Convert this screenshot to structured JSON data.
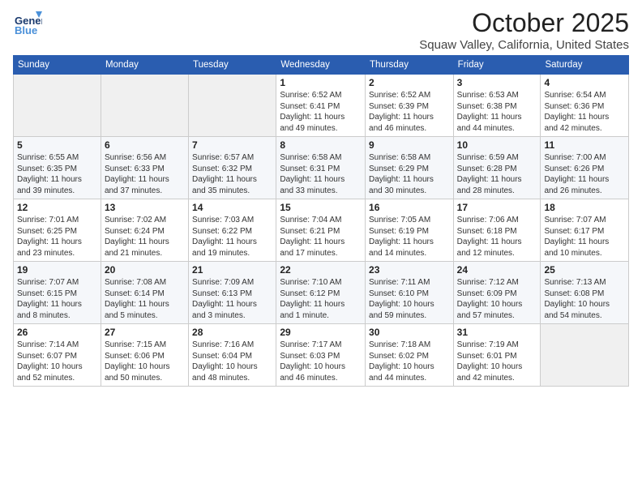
{
  "header": {
    "logo_general": "General",
    "logo_blue": "Blue",
    "month_title": "October 2025",
    "location": "Squaw Valley, California, United States"
  },
  "weekdays": [
    "Sunday",
    "Monday",
    "Tuesday",
    "Wednesday",
    "Thursday",
    "Friday",
    "Saturday"
  ],
  "weeks": [
    [
      {
        "day": "",
        "info": ""
      },
      {
        "day": "",
        "info": ""
      },
      {
        "day": "",
        "info": ""
      },
      {
        "day": "1",
        "info": "Sunrise: 6:52 AM\nSunset: 6:41 PM\nDaylight: 11 hours\nand 49 minutes."
      },
      {
        "day": "2",
        "info": "Sunrise: 6:52 AM\nSunset: 6:39 PM\nDaylight: 11 hours\nand 46 minutes."
      },
      {
        "day": "3",
        "info": "Sunrise: 6:53 AM\nSunset: 6:38 PM\nDaylight: 11 hours\nand 44 minutes."
      },
      {
        "day": "4",
        "info": "Sunrise: 6:54 AM\nSunset: 6:36 PM\nDaylight: 11 hours\nand 42 minutes."
      }
    ],
    [
      {
        "day": "5",
        "info": "Sunrise: 6:55 AM\nSunset: 6:35 PM\nDaylight: 11 hours\nand 39 minutes."
      },
      {
        "day": "6",
        "info": "Sunrise: 6:56 AM\nSunset: 6:33 PM\nDaylight: 11 hours\nand 37 minutes."
      },
      {
        "day": "7",
        "info": "Sunrise: 6:57 AM\nSunset: 6:32 PM\nDaylight: 11 hours\nand 35 minutes."
      },
      {
        "day": "8",
        "info": "Sunrise: 6:58 AM\nSunset: 6:31 PM\nDaylight: 11 hours\nand 33 minutes."
      },
      {
        "day": "9",
        "info": "Sunrise: 6:58 AM\nSunset: 6:29 PM\nDaylight: 11 hours\nand 30 minutes."
      },
      {
        "day": "10",
        "info": "Sunrise: 6:59 AM\nSunset: 6:28 PM\nDaylight: 11 hours\nand 28 minutes."
      },
      {
        "day": "11",
        "info": "Sunrise: 7:00 AM\nSunset: 6:26 PM\nDaylight: 11 hours\nand 26 minutes."
      }
    ],
    [
      {
        "day": "12",
        "info": "Sunrise: 7:01 AM\nSunset: 6:25 PM\nDaylight: 11 hours\nand 23 minutes."
      },
      {
        "day": "13",
        "info": "Sunrise: 7:02 AM\nSunset: 6:24 PM\nDaylight: 11 hours\nand 21 minutes."
      },
      {
        "day": "14",
        "info": "Sunrise: 7:03 AM\nSunset: 6:22 PM\nDaylight: 11 hours\nand 19 minutes."
      },
      {
        "day": "15",
        "info": "Sunrise: 7:04 AM\nSunset: 6:21 PM\nDaylight: 11 hours\nand 17 minutes."
      },
      {
        "day": "16",
        "info": "Sunrise: 7:05 AM\nSunset: 6:19 PM\nDaylight: 11 hours\nand 14 minutes."
      },
      {
        "day": "17",
        "info": "Sunrise: 7:06 AM\nSunset: 6:18 PM\nDaylight: 11 hours\nand 12 minutes."
      },
      {
        "day": "18",
        "info": "Sunrise: 7:07 AM\nSunset: 6:17 PM\nDaylight: 11 hours\nand 10 minutes."
      }
    ],
    [
      {
        "day": "19",
        "info": "Sunrise: 7:07 AM\nSunset: 6:15 PM\nDaylight: 11 hours\nand 8 minutes."
      },
      {
        "day": "20",
        "info": "Sunrise: 7:08 AM\nSunset: 6:14 PM\nDaylight: 11 hours\nand 5 minutes."
      },
      {
        "day": "21",
        "info": "Sunrise: 7:09 AM\nSunset: 6:13 PM\nDaylight: 11 hours\nand 3 minutes."
      },
      {
        "day": "22",
        "info": "Sunrise: 7:10 AM\nSunset: 6:12 PM\nDaylight: 11 hours\nand 1 minute."
      },
      {
        "day": "23",
        "info": "Sunrise: 7:11 AM\nSunset: 6:10 PM\nDaylight: 10 hours\nand 59 minutes."
      },
      {
        "day": "24",
        "info": "Sunrise: 7:12 AM\nSunset: 6:09 PM\nDaylight: 10 hours\nand 57 minutes."
      },
      {
        "day": "25",
        "info": "Sunrise: 7:13 AM\nSunset: 6:08 PM\nDaylight: 10 hours\nand 54 minutes."
      }
    ],
    [
      {
        "day": "26",
        "info": "Sunrise: 7:14 AM\nSunset: 6:07 PM\nDaylight: 10 hours\nand 52 minutes."
      },
      {
        "day": "27",
        "info": "Sunrise: 7:15 AM\nSunset: 6:06 PM\nDaylight: 10 hours\nand 50 minutes."
      },
      {
        "day": "28",
        "info": "Sunrise: 7:16 AM\nSunset: 6:04 PM\nDaylight: 10 hours\nand 48 minutes."
      },
      {
        "day": "29",
        "info": "Sunrise: 7:17 AM\nSunset: 6:03 PM\nDaylight: 10 hours\nand 46 minutes."
      },
      {
        "day": "30",
        "info": "Sunrise: 7:18 AM\nSunset: 6:02 PM\nDaylight: 10 hours\nand 44 minutes."
      },
      {
        "day": "31",
        "info": "Sunrise: 7:19 AM\nSunset: 6:01 PM\nDaylight: 10 hours\nand 42 minutes."
      },
      {
        "day": "",
        "info": ""
      }
    ]
  ]
}
